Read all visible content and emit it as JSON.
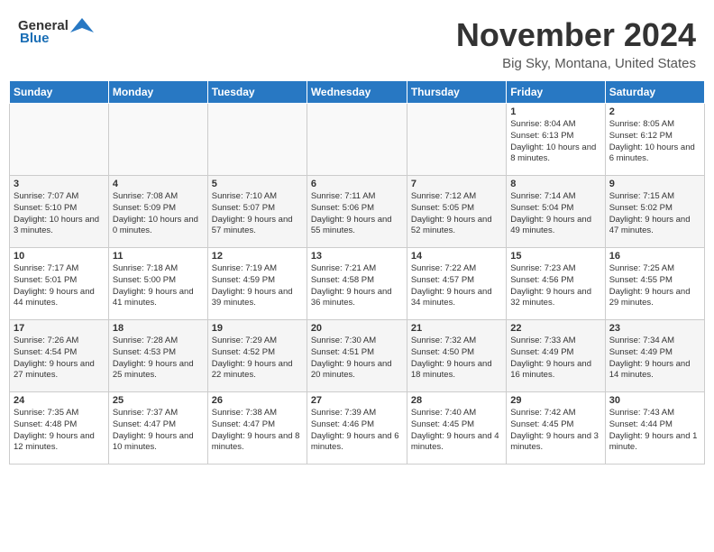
{
  "header": {
    "logo_general": "General",
    "logo_blue": "Blue",
    "month_title": "November 2024",
    "location": "Big Sky, Montana, United States"
  },
  "days_of_week": [
    "Sunday",
    "Monday",
    "Tuesday",
    "Wednesday",
    "Thursday",
    "Friday",
    "Saturday"
  ],
  "weeks": [
    [
      null,
      null,
      null,
      null,
      null,
      {
        "day": 1,
        "sunrise": "Sunrise: 8:04 AM",
        "sunset": "Sunset: 6:13 PM",
        "daylight": "Daylight: 10 hours and 8 minutes."
      },
      {
        "day": 2,
        "sunrise": "Sunrise: 8:05 AM",
        "sunset": "Sunset: 6:12 PM",
        "daylight": "Daylight: 10 hours and 6 minutes."
      }
    ],
    [
      {
        "day": 3,
        "sunrise": "Sunrise: 7:07 AM",
        "sunset": "Sunset: 5:10 PM",
        "daylight": "Daylight: 10 hours and 3 minutes."
      },
      {
        "day": 4,
        "sunrise": "Sunrise: 7:08 AM",
        "sunset": "Sunset: 5:09 PM",
        "daylight": "Daylight: 10 hours and 0 minutes."
      },
      {
        "day": 5,
        "sunrise": "Sunrise: 7:10 AM",
        "sunset": "Sunset: 5:07 PM",
        "daylight": "Daylight: 9 hours and 57 minutes."
      },
      {
        "day": 6,
        "sunrise": "Sunrise: 7:11 AM",
        "sunset": "Sunset: 5:06 PM",
        "daylight": "Daylight: 9 hours and 55 minutes."
      },
      {
        "day": 7,
        "sunrise": "Sunrise: 7:12 AM",
        "sunset": "Sunset: 5:05 PM",
        "daylight": "Daylight: 9 hours and 52 minutes."
      },
      {
        "day": 8,
        "sunrise": "Sunrise: 7:14 AM",
        "sunset": "Sunset: 5:04 PM",
        "daylight": "Daylight: 9 hours and 49 minutes."
      },
      {
        "day": 9,
        "sunrise": "Sunrise: 7:15 AM",
        "sunset": "Sunset: 5:02 PM",
        "daylight": "Daylight: 9 hours and 47 minutes."
      }
    ],
    [
      {
        "day": 10,
        "sunrise": "Sunrise: 7:17 AM",
        "sunset": "Sunset: 5:01 PM",
        "daylight": "Daylight: 9 hours and 44 minutes."
      },
      {
        "day": 11,
        "sunrise": "Sunrise: 7:18 AM",
        "sunset": "Sunset: 5:00 PM",
        "daylight": "Daylight: 9 hours and 41 minutes."
      },
      {
        "day": 12,
        "sunrise": "Sunrise: 7:19 AM",
        "sunset": "Sunset: 4:59 PM",
        "daylight": "Daylight: 9 hours and 39 minutes."
      },
      {
        "day": 13,
        "sunrise": "Sunrise: 7:21 AM",
        "sunset": "Sunset: 4:58 PM",
        "daylight": "Daylight: 9 hours and 36 minutes."
      },
      {
        "day": 14,
        "sunrise": "Sunrise: 7:22 AM",
        "sunset": "Sunset: 4:57 PM",
        "daylight": "Daylight: 9 hours and 34 minutes."
      },
      {
        "day": 15,
        "sunrise": "Sunrise: 7:23 AM",
        "sunset": "Sunset: 4:56 PM",
        "daylight": "Daylight: 9 hours and 32 minutes."
      },
      {
        "day": 16,
        "sunrise": "Sunrise: 7:25 AM",
        "sunset": "Sunset: 4:55 PM",
        "daylight": "Daylight: 9 hours and 29 minutes."
      }
    ],
    [
      {
        "day": 17,
        "sunrise": "Sunrise: 7:26 AM",
        "sunset": "Sunset: 4:54 PM",
        "daylight": "Daylight: 9 hours and 27 minutes."
      },
      {
        "day": 18,
        "sunrise": "Sunrise: 7:28 AM",
        "sunset": "Sunset: 4:53 PM",
        "daylight": "Daylight: 9 hours and 25 minutes."
      },
      {
        "day": 19,
        "sunrise": "Sunrise: 7:29 AM",
        "sunset": "Sunset: 4:52 PM",
        "daylight": "Daylight: 9 hours and 22 minutes."
      },
      {
        "day": 20,
        "sunrise": "Sunrise: 7:30 AM",
        "sunset": "Sunset: 4:51 PM",
        "daylight": "Daylight: 9 hours and 20 minutes."
      },
      {
        "day": 21,
        "sunrise": "Sunrise: 7:32 AM",
        "sunset": "Sunset: 4:50 PM",
        "daylight": "Daylight: 9 hours and 18 minutes."
      },
      {
        "day": 22,
        "sunrise": "Sunrise: 7:33 AM",
        "sunset": "Sunset: 4:49 PM",
        "daylight": "Daylight: 9 hours and 16 minutes."
      },
      {
        "day": 23,
        "sunrise": "Sunrise: 7:34 AM",
        "sunset": "Sunset: 4:49 PM",
        "daylight": "Daylight: 9 hours and 14 minutes."
      }
    ],
    [
      {
        "day": 24,
        "sunrise": "Sunrise: 7:35 AM",
        "sunset": "Sunset: 4:48 PM",
        "daylight": "Daylight: 9 hours and 12 minutes."
      },
      {
        "day": 25,
        "sunrise": "Sunrise: 7:37 AM",
        "sunset": "Sunset: 4:47 PM",
        "daylight": "Daylight: 9 hours and 10 minutes."
      },
      {
        "day": 26,
        "sunrise": "Sunrise: 7:38 AM",
        "sunset": "Sunset: 4:47 PM",
        "daylight": "Daylight: 9 hours and 8 minutes."
      },
      {
        "day": 27,
        "sunrise": "Sunrise: 7:39 AM",
        "sunset": "Sunset: 4:46 PM",
        "daylight": "Daylight: 9 hours and 6 minutes."
      },
      {
        "day": 28,
        "sunrise": "Sunrise: 7:40 AM",
        "sunset": "Sunset: 4:45 PM",
        "daylight": "Daylight: 9 hours and 4 minutes."
      },
      {
        "day": 29,
        "sunrise": "Sunrise: 7:42 AM",
        "sunset": "Sunset: 4:45 PM",
        "daylight": "Daylight: 9 hours and 3 minutes."
      },
      {
        "day": 30,
        "sunrise": "Sunrise: 7:43 AM",
        "sunset": "Sunset: 4:44 PM",
        "daylight": "Daylight: 9 hours and 1 minute."
      }
    ]
  ]
}
